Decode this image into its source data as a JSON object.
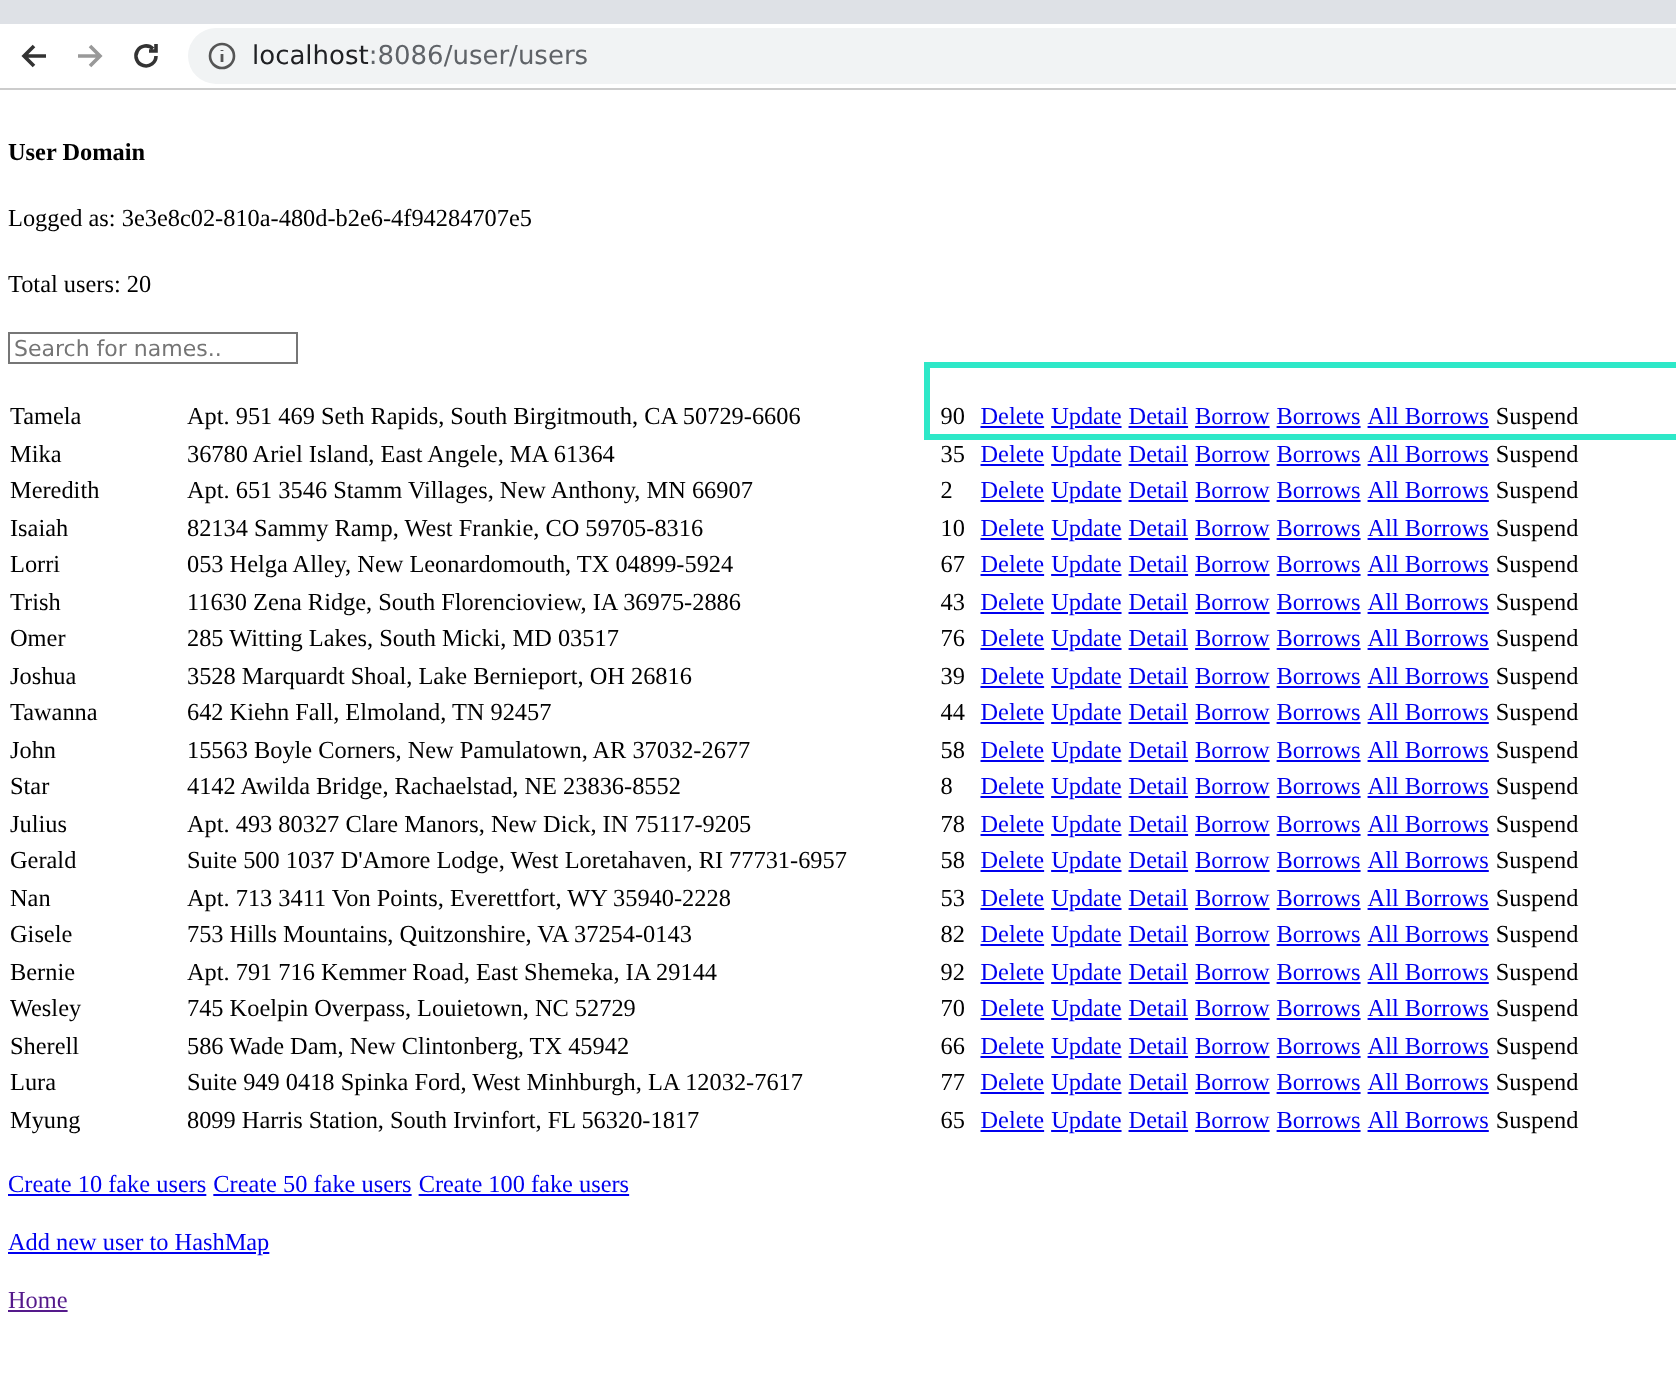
{
  "browser": {
    "address": {
      "host": "localhost",
      "path": ":8086/user/users"
    }
  },
  "page": {
    "title": "User Domain",
    "logged_as": "Logged as: 3e3e8c02-810a-480d-b2e6-4f94284707e5",
    "total_users": "Total users: 20",
    "search": {
      "placeholder": "Search for names.."
    },
    "users": [
      {
        "name": "Tamela",
        "address": "Apt. 951 469 Seth Rapids, South Birgitmouth, CA 50729-6606",
        "score": "90",
        "highlighted": true,
        "actions": [
          {
            "label": "Delete",
            "kind": "link"
          },
          {
            "label": "Update",
            "kind": "link"
          },
          {
            "label": "Detail",
            "kind": "link"
          },
          {
            "label": "Borrow",
            "kind": "link"
          },
          {
            "label": "Borrows",
            "kind": "link"
          },
          {
            "label": "All Borrows",
            "kind": "link"
          },
          {
            "label": "Suspend",
            "kind": "text"
          }
        ]
      },
      {
        "name": "Mika",
        "address": "36780 Ariel Island, East Angele, MA 61364",
        "score": "35",
        "highlighted": false,
        "actions": [
          {
            "label": "Delete",
            "kind": "link"
          },
          {
            "label": "Update",
            "kind": "link"
          },
          {
            "label": "Detail",
            "kind": "link"
          },
          {
            "label": "Borrow",
            "kind": "link"
          },
          {
            "label": "Borrows",
            "kind": "link"
          },
          {
            "label": "All Borrows",
            "kind": "link"
          },
          {
            "label": "Suspend",
            "kind": "text"
          }
        ]
      },
      {
        "name": "Meredith",
        "address": "Apt. 651 3546 Stamm Villages, New Anthony, MN 66907",
        "score": "2",
        "highlighted": false,
        "actions": [
          {
            "label": "Delete",
            "kind": "link"
          },
          {
            "label": "Update",
            "kind": "link"
          },
          {
            "label": "Detail",
            "kind": "link"
          },
          {
            "label": "Borrow",
            "kind": "link"
          },
          {
            "label": "Borrows",
            "kind": "link"
          },
          {
            "label": "All Borrows",
            "kind": "link"
          },
          {
            "label": "Suspend",
            "kind": "text"
          }
        ]
      },
      {
        "name": "Isaiah",
        "address": "82134 Sammy Ramp, West Frankie, CO 59705-8316",
        "score": "10",
        "highlighted": false,
        "actions": [
          {
            "label": "Delete",
            "kind": "link"
          },
          {
            "label": "Update",
            "kind": "link"
          },
          {
            "label": "Detail",
            "kind": "link"
          },
          {
            "label": "Borrow",
            "kind": "link"
          },
          {
            "label": "Borrows",
            "kind": "link"
          },
          {
            "label": "All Borrows",
            "kind": "link"
          },
          {
            "label": "Suspend",
            "kind": "text"
          }
        ]
      },
      {
        "name": "Lorri",
        "address": "053 Helga Alley, New Leonardomouth, TX 04899-5924",
        "score": "67",
        "highlighted": false,
        "actions": [
          {
            "label": "Delete",
            "kind": "link"
          },
          {
            "label": "Update",
            "kind": "link"
          },
          {
            "label": "Detail",
            "kind": "link"
          },
          {
            "label": "Borrow",
            "kind": "link"
          },
          {
            "label": "Borrows",
            "kind": "link"
          },
          {
            "label": "All Borrows",
            "kind": "link"
          },
          {
            "label": "Suspend",
            "kind": "text"
          }
        ]
      },
      {
        "name": "Trish",
        "address": "11630 Zena Ridge, South Florencioview, IA 36975-2886",
        "score": "43",
        "highlighted": false,
        "actions": [
          {
            "label": "Delete",
            "kind": "link"
          },
          {
            "label": "Update",
            "kind": "link"
          },
          {
            "label": "Detail",
            "kind": "link"
          },
          {
            "label": "Borrow",
            "kind": "link"
          },
          {
            "label": "Borrows",
            "kind": "link"
          },
          {
            "label": "All Borrows",
            "kind": "link"
          },
          {
            "label": "Suspend",
            "kind": "text"
          }
        ]
      },
      {
        "name": "Omer",
        "address": "285 Witting Lakes, South Micki, MD 03517",
        "score": "76",
        "highlighted": false,
        "actions": [
          {
            "label": "Delete",
            "kind": "link"
          },
          {
            "label": "Update",
            "kind": "link"
          },
          {
            "label": "Detail",
            "kind": "link"
          },
          {
            "label": "Borrow",
            "kind": "link"
          },
          {
            "label": "Borrows",
            "kind": "link"
          },
          {
            "label": "All Borrows",
            "kind": "link"
          },
          {
            "label": "Suspend",
            "kind": "text"
          }
        ]
      },
      {
        "name": "Joshua",
        "address": "3528 Marquardt Shoal, Lake Bernieport, OH 26816",
        "score": "39",
        "highlighted": false,
        "actions": [
          {
            "label": "Delete",
            "kind": "link"
          },
          {
            "label": "Update",
            "kind": "link"
          },
          {
            "label": "Detail",
            "kind": "link"
          },
          {
            "label": "Borrow",
            "kind": "link"
          },
          {
            "label": "Borrows",
            "kind": "link"
          },
          {
            "label": "All Borrows",
            "kind": "link"
          },
          {
            "label": "Suspend",
            "kind": "text"
          }
        ]
      },
      {
        "name": "Tawanna",
        "address": "642 Kiehn Fall, Elmoland, TN 92457",
        "score": "44",
        "highlighted": false,
        "actions": [
          {
            "label": "Delete",
            "kind": "link"
          },
          {
            "label": "Update",
            "kind": "link"
          },
          {
            "label": "Detail",
            "kind": "link"
          },
          {
            "label": "Borrow",
            "kind": "link"
          },
          {
            "label": "Borrows",
            "kind": "link"
          },
          {
            "label": "All Borrows",
            "kind": "link"
          },
          {
            "label": "Suspend",
            "kind": "text"
          }
        ]
      },
      {
        "name": "John",
        "address": "15563 Boyle Corners, New Pamulatown, AR 37032-2677",
        "score": "58",
        "highlighted": false,
        "actions": [
          {
            "label": "Delete",
            "kind": "link"
          },
          {
            "label": "Update",
            "kind": "link"
          },
          {
            "label": "Detail",
            "kind": "link"
          },
          {
            "label": "Borrow",
            "kind": "link"
          },
          {
            "label": "Borrows",
            "kind": "link"
          },
          {
            "label": "All Borrows",
            "kind": "link"
          },
          {
            "label": "Suspend",
            "kind": "text"
          }
        ]
      },
      {
        "name": "Star",
        "address": "4142 Awilda Bridge, Rachaelstad, NE 23836-8552",
        "score": "8",
        "highlighted": false,
        "actions": [
          {
            "label": "Delete",
            "kind": "link"
          },
          {
            "label": "Update",
            "kind": "link"
          },
          {
            "label": "Detail",
            "kind": "link"
          },
          {
            "label": "Borrow",
            "kind": "link"
          },
          {
            "label": "Borrows",
            "kind": "link"
          },
          {
            "label": "All Borrows",
            "kind": "link"
          },
          {
            "label": "Suspend",
            "kind": "text"
          }
        ]
      },
      {
        "name": "Julius",
        "address": "Apt. 493 80327 Clare Manors, New Dick, IN 75117-9205",
        "score": "78",
        "highlighted": false,
        "actions": [
          {
            "label": "Delete",
            "kind": "link"
          },
          {
            "label": "Update",
            "kind": "link"
          },
          {
            "label": "Detail",
            "kind": "link"
          },
          {
            "label": "Borrow",
            "kind": "link"
          },
          {
            "label": "Borrows",
            "kind": "link"
          },
          {
            "label": "All Borrows",
            "kind": "link"
          },
          {
            "label": "Suspend",
            "kind": "text"
          }
        ]
      },
      {
        "name": "Gerald",
        "address": "Suite 500 1037 D'Amore Lodge, West Loretahaven, RI 77731-6957",
        "score": "58",
        "highlighted": false,
        "actions": [
          {
            "label": "Delete",
            "kind": "link"
          },
          {
            "label": "Update",
            "kind": "link"
          },
          {
            "label": "Detail",
            "kind": "link"
          },
          {
            "label": "Borrow",
            "kind": "link"
          },
          {
            "label": "Borrows",
            "kind": "link"
          },
          {
            "label": "All Borrows",
            "kind": "link"
          },
          {
            "label": "Suspend",
            "kind": "text"
          }
        ]
      },
      {
        "name": "Nan",
        "address": "Apt. 713 3411 Von Points, Everettfort, WY 35940-2228",
        "score": "53",
        "highlighted": false,
        "actions": [
          {
            "label": "Delete",
            "kind": "link"
          },
          {
            "label": "Update",
            "kind": "link"
          },
          {
            "label": "Detail",
            "kind": "link"
          },
          {
            "label": "Borrow",
            "kind": "link"
          },
          {
            "label": "Borrows",
            "kind": "link"
          },
          {
            "label": "All Borrows",
            "kind": "link"
          },
          {
            "label": "Suspend",
            "kind": "text"
          }
        ]
      },
      {
        "name": "Gisele",
        "address": "753 Hills Mountains, Quitzonshire, VA 37254-0143",
        "score": "82",
        "highlighted": false,
        "actions": [
          {
            "label": "Delete",
            "kind": "link"
          },
          {
            "label": "Update",
            "kind": "link"
          },
          {
            "label": "Detail",
            "kind": "link"
          },
          {
            "label": "Borrow",
            "kind": "link"
          },
          {
            "label": "Borrows",
            "kind": "link"
          },
          {
            "label": "All Borrows",
            "kind": "link"
          },
          {
            "label": "Suspend",
            "kind": "text"
          }
        ]
      },
      {
        "name": "Bernie",
        "address": "Apt. 791 716 Kemmer Road, East Shemeka, IA 29144",
        "score": "92",
        "highlighted": false,
        "actions": [
          {
            "label": "Delete",
            "kind": "link"
          },
          {
            "label": "Update",
            "kind": "link"
          },
          {
            "label": "Detail",
            "kind": "link"
          },
          {
            "label": "Borrow",
            "kind": "link"
          },
          {
            "label": "Borrows",
            "kind": "link"
          },
          {
            "label": "All Borrows",
            "kind": "link"
          },
          {
            "label": "Suspend",
            "kind": "text"
          }
        ]
      },
      {
        "name": "Wesley",
        "address": "745 Koelpin Overpass, Louietown, NC 52729",
        "score": "70",
        "highlighted": false,
        "actions": [
          {
            "label": "Delete",
            "kind": "link"
          },
          {
            "label": "Update",
            "kind": "link"
          },
          {
            "label": "Detail",
            "kind": "link"
          },
          {
            "label": "Borrow",
            "kind": "link"
          },
          {
            "label": "Borrows",
            "kind": "link"
          },
          {
            "label": "All Borrows",
            "kind": "link"
          },
          {
            "label": "Suspend",
            "kind": "text"
          }
        ]
      },
      {
        "name": "Sherell",
        "address": "586 Wade Dam, New Clintonberg, TX 45942",
        "score": "66",
        "highlighted": false,
        "actions": [
          {
            "label": "Delete",
            "kind": "link"
          },
          {
            "label": "Update",
            "kind": "link"
          },
          {
            "label": "Detail",
            "kind": "link"
          },
          {
            "label": "Borrow",
            "kind": "link"
          },
          {
            "label": "Borrows",
            "kind": "link"
          },
          {
            "label": "All Borrows",
            "kind": "link"
          },
          {
            "label": "Suspend",
            "kind": "text"
          }
        ]
      },
      {
        "name": "Lura",
        "address": "Suite 949 0418 Spinka Ford, West Minhburgh, LA 12032-7617",
        "score": "77",
        "highlighted": false,
        "actions": [
          {
            "label": "Delete",
            "kind": "link"
          },
          {
            "label": "Update",
            "kind": "link"
          },
          {
            "label": "Detail",
            "kind": "link"
          },
          {
            "label": "Borrow",
            "kind": "link"
          },
          {
            "label": "Borrows",
            "kind": "link"
          },
          {
            "label": "All Borrows",
            "kind": "link"
          },
          {
            "label": "Suspend",
            "kind": "text"
          }
        ]
      },
      {
        "name": "Myung",
        "address": "8099 Harris Station, South Irvinfort, FL 56320-1817",
        "score": "65",
        "highlighted": false,
        "actions": [
          {
            "label": "Delete",
            "kind": "link"
          },
          {
            "label": "Update",
            "kind": "link"
          },
          {
            "label": "Detail",
            "kind": "link"
          },
          {
            "label": "Borrow",
            "kind": "link"
          },
          {
            "label": "Borrows",
            "kind": "link"
          },
          {
            "label": "All Borrows",
            "kind": "link"
          },
          {
            "label": "Suspend",
            "kind": "text"
          }
        ]
      }
    ],
    "link_rows": [
      [
        {
          "label": "Create 10 fake users",
          "visited": false
        },
        {
          "label": "Create 50 fake users",
          "visited": false
        },
        {
          "label": "Create 100 fake users",
          "visited": false
        }
      ],
      [
        {
          "label": "Add new user to HashMap",
          "visited": false
        }
      ],
      [
        {
          "label": "Home",
          "visited": true
        }
      ]
    ]
  }
}
